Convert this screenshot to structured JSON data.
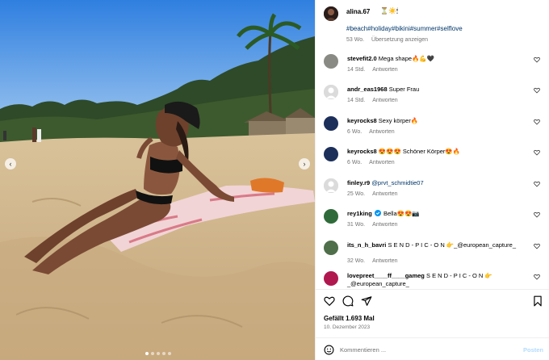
{
  "post": {
    "username": "alina.67",
    "caption_emojis": "⏳☀️🕯",
    "hashtags": "#beach#holiday#bikini#summer#selflove",
    "age": "53 Wo.",
    "translate_label": "Übersetzung anzeigen"
  },
  "media": {
    "prev_glyph": "‹",
    "next_glyph": "›",
    "slide_count": 5,
    "active_slide": 1
  },
  "comments": [
    {
      "username": "stevefit2.0",
      "text": "Mega shape🔥💪🖤",
      "age": "14 Std.",
      "reply_label": "Antworten",
      "avatar_color": "#8a8a84"
    },
    {
      "username": "andr_eas1968",
      "text": "Super Frau",
      "age": "14 Std.",
      "reply_label": "Antworten",
      "avatar_color": "#dbdbdb"
    },
    {
      "username": "keyrocks8",
      "text": "Sexy körper🔥",
      "age": "6 Wo.",
      "reply_label": "Antworten",
      "avatar_color": "#1c2f5a"
    },
    {
      "username": "keyrocks8",
      "text": "😍😍😍 Schöner Körper😍🔥",
      "age": "6 Wo.",
      "reply_label": "Antworten",
      "avatar_color": "#1c2f5a"
    },
    {
      "username": "finley.r9",
      "text": "@prvt_schmidtie07",
      "age": "25 Wo.",
      "reply_label": "Antworten",
      "avatar_color": "#dbdbdb",
      "mention": true
    },
    {
      "username": "rey1king",
      "verified": true,
      "text": "Bella😍😍📷",
      "age": "31 Wo.",
      "reply_label": "Antworten",
      "avatar_color": "#2f6b3a"
    },
    {
      "username": "its_n_h_bavri",
      "text": "S E N D - P I C - O N 👉_@european_capture_",
      "age": "32 Wo.",
      "reply_label": "Antworten",
      "avatar_color": "#4f6e4a"
    },
    {
      "username": "lovepreet____ff____gameg",
      "text": "S E N D - P I C - O N 👉 _@european_capture_",
      "age": "",
      "reply_label": "",
      "avatar_color": "#b0174f"
    }
  ],
  "likes": "Gefällt 1.693 Mal",
  "date": "10. Dezember 2023",
  "comment_input": {
    "placeholder": "Kommentieren ...",
    "value": ""
  },
  "post_button": "Posten",
  "icons": [
    "heart-icon",
    "comment-icon",
    "share-icon",
    "bookmark-icon",
    "emoji-icon",
    "chevron-left-icon",
    "chevron-right-icon",
    "verified-badge-icon"
  ],
  "colors": {
    "link": "#00376b",
    "muted": "#737373",
    "verified": "#0095f6",
    "post_disabled": "#b3dbff"
  }
}
